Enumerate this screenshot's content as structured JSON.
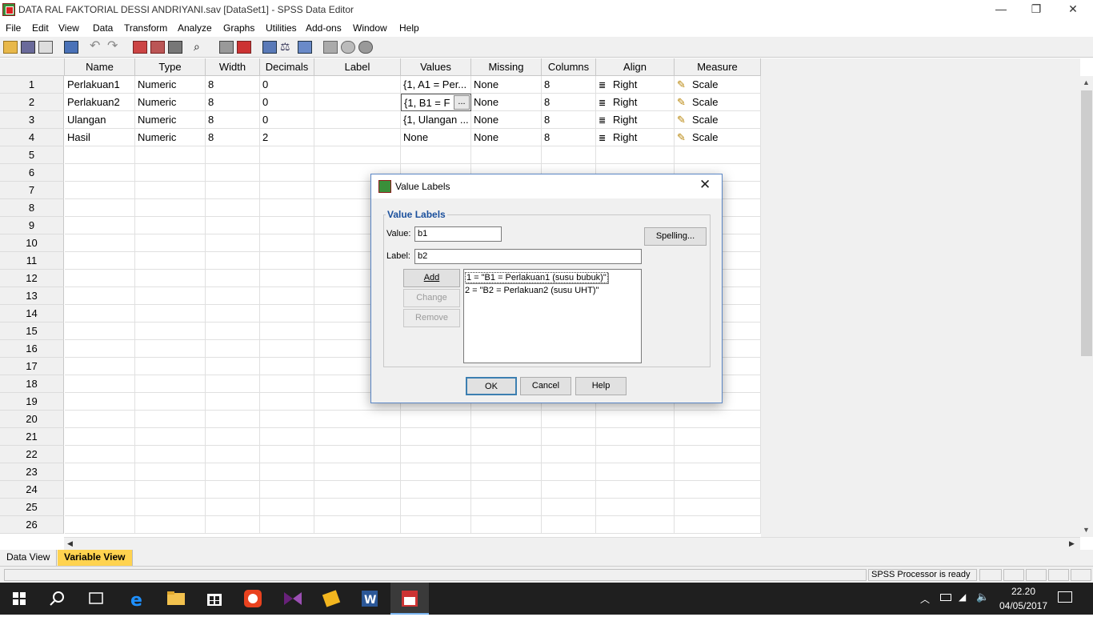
{
  "window": {
    "title": "DATA RAL FAKTORIAL DESSI ANDRIYANI.sav [DataSet1] - SPSS Data Editor",
    "minimize": "—",
    "restore": "❐",
    "close": "✕"
  },
  "menu": [
    "File",
    "Edit",
    "View",
    "Data",
    "Transform",
    "Analyze",
    "Graphs",
    "Utilities",
    "Add-ons",
    "Window",
    "Help"
  ],
  "grid": {
    "columns": [
      "Name",
      "Type",
      "Width",
      "Decimals",
      "Label",
      "Values",
      "Missing",
      "Columns",
      "Align",
      "Measure"
    ],
    "rows": [
      {
        "num": "1",
        "name": "Perlakuan1",
        "type": "Numeric",
        "width": "8",
        "decimals": "0",
        "label": "",
        "values": "{1, A1 = Per...",
        "missing": "None",
        "columns": "8",
        "align": "Right",
        "measure": "Scale"
      },
      {
        "num": "2",
        "name": "Perlakuan2",
        "type": "Numeric",
        "width": "8",
        "decimals": "0",
        "label": "",
        "values": "{1, B1 = F",
        "missing": "None",
        "columns": "8",
        "align": "Right",
        "measure": "Scale"
      },
      {
        "num": "3",
        "name": "Ulangan",
        "type": "Numeric",
        "width": "8",
        "decimals": "0",
        "label": "",
        "values": "{1, Ulangan ...",
        "missing": "None",
        "columns": "8",
        "align": "Right",
        "measure": "Scale"
      },
      {
        "num": "4",
        "name": "Hasil",
        "type": "Numeric",
        "width": "8",
        "decimals": "2",
        "label": "",
        "values": "None",
        "missing": "None",
        "columns": "8",
        "align": "Right",
        "measure": "Scale"
      }
    ],
    "empty_rows": [
      "5",
      "6",
      "7",
      "8",
      "9",
      "10",
      "11",
      "12",
      "13",
      "14",
      "15",
      "16",
      "17",
      "18",
      "19",
      "20",
      "21",
      "22",
      "23",
      "24",
      "25",
      "26"
    ],
    "ellipsis_button": "..."
  },
  "tabs": {
    "data_view": "Data View",
    "variable_view": "Variable View"
  },
  "status": {
    "processor": "SPSS  Processor is ready"
  },
  "dialog": {
    "title": "Value Labels",
    "group_title": "Value Labels",
    "value_label": "Value:",
    "value": "b1",
    "label_label": "Label:",
    "label_value": "b2",
    "spelling": "Spelling...",
    "add": "Add",
    "change": "Change",
    "remove": "Remove",
    "list": [
      "1 = \"B1 = Perlakuan1 (susu bubuk)\"",
      "2 = \"B2 = Perlakuan2 (susu UHT)\""
    ],
    "ok": "OK",
    "cancel": "Cancel",
    "help": "Help"
  },
  "taskbar": {
    "time": "22.20",
    "date": "04/05/2017"
  },
  "colors": {
    "accent": "#ffd34f",
    "taskbar": "#1f1f1f",
    "dialog_group_title": "#1a4f9c"
  }
}
